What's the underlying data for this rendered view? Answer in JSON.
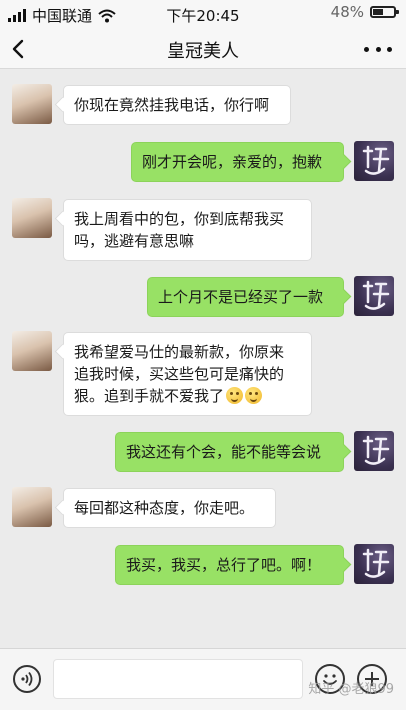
{
  "status_bar": {
    "carrier": "中国联通",
    "time": "下午20:45",
    "battery": "48%",
    "battery_level": 0.48,
    "icons": [
      "signal-icon",
      "wifi-icon",
      "battery-icon"
    ]
  },
  "nav": {
    "title": "皇冠美人",
    "back_icon": "chevron-left-icon",
    "more_icon": "more-dots-icon"
  },
  "messages": [
    {
      "side": "left",
      "text": "你现在竟然挂我电话，你行啊"
    },
    {
      "side": "right",
      "text": "刚才开会呢，亲爱的，抱歉"
    },
    {
      "side": "left",
      "lines": [
        "我上周看中的包，你到底帮我买",
        "吗，逃避有意思嘛"
      ]
    },
    {
      "side": "right",
      "text": "上个月不是已经买了一款"
    },
    {
      "side": "left",
      "lines": [
        "我希望爱马仕的最新款，你原来",
        "追我时候，买这些包可是痛快的",
        "狠。追到手就不爱我了"
      ],
      "emojis": [
        "smile-emoji",
        "smile-emoji"
      ]
    },
    {
      "side": "right",
      "text": "我这还有个会，能不能等会说"
    },
    {
      "side": "left",
      "text": "每回都这种态度，你走吧。"
    },
    {
      "side": "right",
      "text": "我买，我买，总行了吧。啊！"
    }
  ],
  "input_bar": {
    "voice_icon": "voice-icon",
    "input_value": "",
    "emoji_icon": "emoji-icon",
    "plus_icon": "plus-icon"
  },
  "watermark": "知乎 @老狼99",
  "colors": {
    "background": "#ebebeb",
    "bubble_self": "#98e165",
    "bubble_other": "#ffffff",
    "bar": "#f7f7f7"
  }
}
